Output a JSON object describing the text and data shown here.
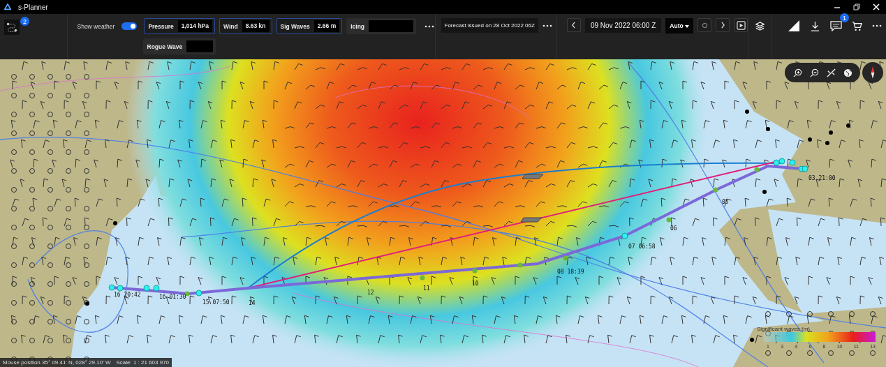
{
  "window": {
    "title": "s-Planner"
  },
  "toolbar": {
    "routes_badge": "2",
    "show_weather": {
      "label": "Show weather",
      "on": true
    },
    "readouts": [
      {
        "label": "Pressure",
        "value": "1,014 hPa",
        "active": true
      },
      {
        "label": "Wind",
        "value": "8.63 kn",
        "active": true
      },
      {
        "label": "Sig Waves",
        "value": "2.66 m",
        "active": true
      },
      {
        "label": "Icing",
        "active": false
      },
      {
        "label": "Rogue Wave",
        "active": false
      }
    ],
    "forecast": "Forecast issued on 28 Oct 2022 06Z",
    "time": "09 Nov 2022 06:00 Z",
    "playback_mode": "Auto",
    "messages_badge": "1"
  },
  "map": {
    "route_labels": [
      {
        "text": "16 20:42"
      },
      {
        "text": "16 01:30"
      },
      {
        "text": "15 07:50"
      },
      {
        "text": "14"
      },
      {
        "text": "12"
      },
      {
        "text": "11"
      },
      {
        "text": "10"
      },
      {
        "text": "08 18:39"
      },
      {
        "text": "07 06:58"
      },
      {
        "text": "06"
      },
      {
        "text": "05"
      },
      {
        "text": "03 21:00"
      }
    ],
    "legend": {
      "title": "Significant waves (m)",
      "ticks": [
        "1",
        "3",
        "4",
        "6",
        "8",
        "10",
        "11",
        "13"
      ]
    }
  },
  "status_bar": {
    "mouse_position": "Mouse position 35° 09.41' N, 028° 29.10' W",
    "scale": "Scale: 1 : 21 603 970"
  }
}
